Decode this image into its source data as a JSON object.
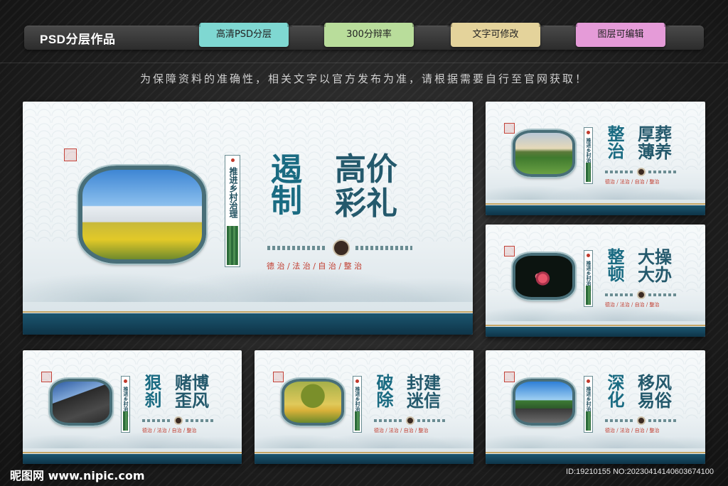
{
  "header": {
    "title": "PSD分层作品",
    "tags": [
      {
        "label": "高清PSD分层",
        "color": "#7fd8d2"
      },
      {
        "label": "300分辩率",
        "color": "#b9dd9b"
      },
      {
        "label": "文字可修改",
        "color": "#e4d39b"
      },
      {
        "label": "图层可编辑",
        "color": "#e59bd8"
      }
    ]
  },
  "notice": "为保障资料的准确性，相关文字以官方发布为准，请根据需要自行至官网获取！",
  "boards": [
    {
      "vertical": "推进乡村治理",
      "title_a": "遏制",
      "title_b": "高价彩礼",
      "subtitle": "德 治 / 法 治 / 自 治 / 整 治",
      "scene": "village"
    },
    {
      "vertical": "推进乡村治理",
      "title_a": "整治",
      "title_b": "厚葬薄养",
      "subtitle": "德治 / 法治 / 自治 / 整治",
      "scene": "tea"
    },
    {
      "vertical": "推进乡村治理",
      "title_a": "整顿",
      "title_b": "大操大办",
      "subtitle": "德治 / 法治 / 自治 / 整治",
      "scene": "plum"
    },
    {
      "vertical": "推进乡村治理",
      "title_a": "狠刹",
      "title_b": "赌博歪风",
      "subtitle": "德治 / 法治 / 自治 / 整治",
      "scene": "roof"
    },
    {
      "vertical": "推进乡村治理",
      "title_a": "破除",
      "title_b": "封建迷信",
      "subtitle": "德治 / 法治 / 自治 / 整治",
      "scene": "tree"
    },
    {
      "vertical": "推进乡村治理",
      "title_a": "深化",
      "title_b": "移风易俗",
      "subtitle": "德治 / 法治 / 自治 / 整治",
      "scene": "house"
    }
  ],
  "watermark": {
    "left": "昵图网 www.nipic.com",
    "right": "ID:19210155 NO:20230414140603674100"
  }
}
